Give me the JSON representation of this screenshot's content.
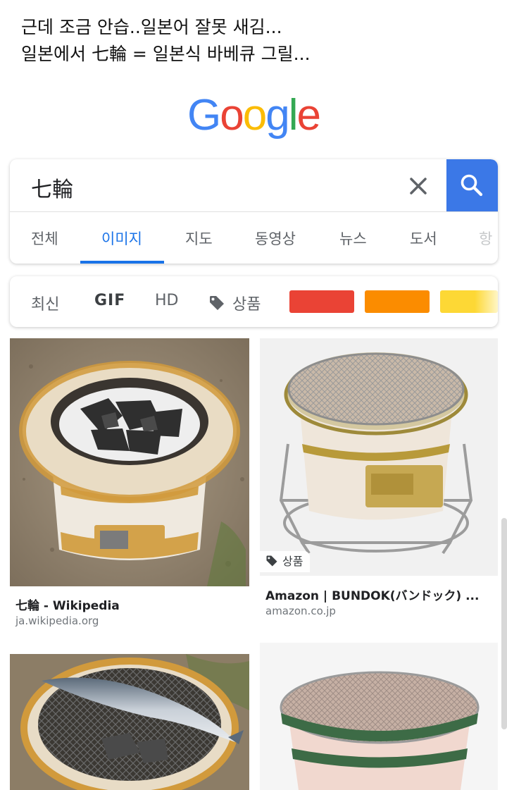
{
  "caption": {
    "line1": "근데 조금 안습..일본어 잘못 새김...",
    "line2": "일본에서 七輪 = 일본식 바베큐 그릴..."
  },
  "logo": {
    "letters": [
      "G",
      "o",
      "o",
      "g",
      "l",
      "e"
    ],
    "colors": [
      "#4285F4",
      "#EA4335",
      "#FBBC05",
      "#4285F4",
      "#34A853",
      "#EA4335"
    ]
  },
  "search": {
    "query": "七輪",
    "clear_icon": "close-icon",
    "search_icon": "search-icon",
    "accent": "#3b78e7"
  },
  "tabs": [
    {
      "label": "전체",
      "active": false
    },
    {
      "label": "이미지",
      "active": true
    },
    {
      "label": "지도",
      "active": false
    },
    {
      "label": "동영상",
      "active": false
    },
    {
      "label": "뉴스",
      "active": false
    },
    {
      "label": "도서",
      "active": false
    },
    {
      "label": "항",
      "active": false
    }
  ],
  "filters": {
    "latest": "최신",
    "gif": "GIF",
    "hd": "HD",
    "product": "상품",
    "colors": [
      "#ea4335",
      "#fb8c00",
      "#fdd835"
    ]
  },
  "results": [
    {
      "title": "七輪 - Wikipedia",
      "source": "ja.wikipedia.org"
    },
    {
      "title": "Amazon | BUNDOK(バンドック) ...",
      "source": "amazon.co.jp",
      "badge": "상품"
    },
    {
      "title": "",
      "source": ""
    },
    {
      "title": "",
      "source": ""
    }
  ]
}
